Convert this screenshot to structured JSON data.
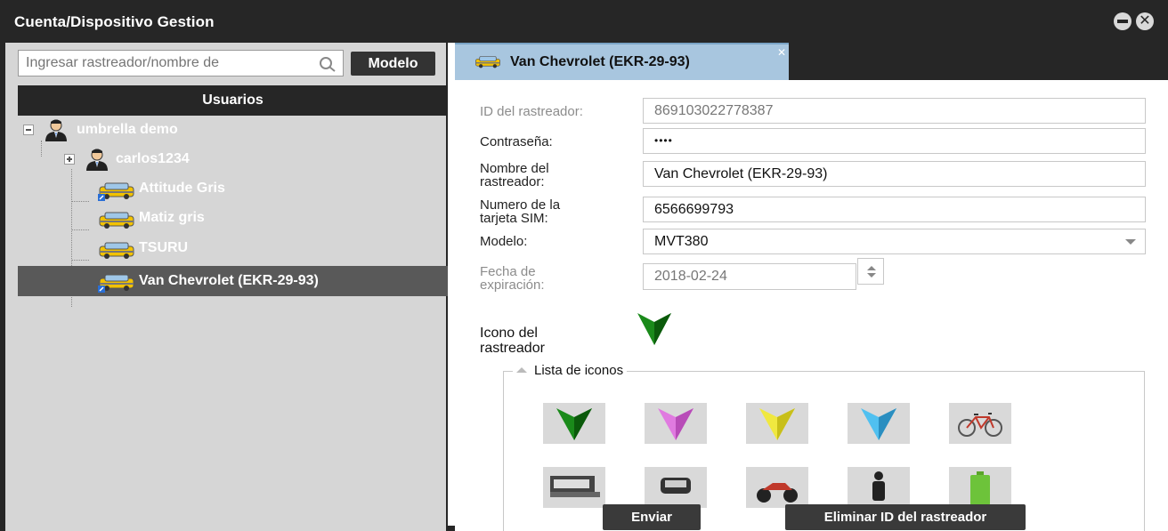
{
  "window": {
    "title": "Cuenta/Dispositivo Gestion"
  },
  "sidebar": {
    "search_placeholder": "Ingresar rastreador/nombre de",
    "model_button": "Modelo",
    "users_header": "Usuarios",
    "tree": [
      {
        "label": "umbrella demo",
        "type": "user",
        "expander": "minus",
        "level": 0
      },
      {
        "label": "carlos1234",
        "type": "user",
        "expander": "plus",
        "level": 1
      },
      {
        "label": "Attitude Gris",
        "type": "vehicle",
        "level": 2
      },
      {
        "label": "Matiz gris",
        "type": "vehicle",
        "level": 2
      },
      {
        "label": "TSURU",
        "type": "vehicle",
        "level": 2
      },
      {
        "label": "Van Chevrolet (EKR-29-93)",
        "type": "vehicle",
        "level": 2,
        "selected": true
      }
    ]
  },
  "tab": {
    "label": "Van Chevrolet (EKR-29-93)"
  },
  "form": {
    "tracker_id_label": "ID del rastreador:",
    "tracker_id_value": "869103022778387",
    "password_label": "Contraseña:",
    "password_value": "••••",
    "name_label_1": "Nombre del",
    "name_label_2": "rastreador:",
    "name_value": "Van Chevrolet (EKR-29-93)",
    "sim_label_1": "Numero de la",
    "sim_label_2": "tarjeta SIM:",
    "sim_value": "6566699793",
    "model_label": "Modelo:",
    "model_value": "MVT380",
    "expiry_label_1": "Fecha de",
    "expiry_label_2": "expiración:",
    "expiry_value": "2018-02-24",
    "icon_label_1": "Icono del",
    "icon_label_2": "rastreador",
    "icon_list_legend": "Lista de iconos",
    "icons": [
      {
        "name": "green-arrow-icon",
        "color": "#1a8a1a"
      },
      {
        "name": "pink-arrow-icon",
        "color": "#e07ae0"
      },
      {
        "name": "yellow-arrow-icon",
        "color": "#e8e030"
      },
      {
        "name": "blue-arrow-icon",
        "color": "#40b0e8"
      },
      {
        "name": "bicycle-icon"
      },
      {
        "name": "truck-icon"
      },
      {
        "name": "car-icon"
      },
      {
        "name": "motorcycle-icon"
      },
      {
        "name": "person-icon"
      },
      {
        "name": "battery-icon"
      }
    ],
    "submit_button": "Enviar",
    "delete_button": "Eliminar ID del rastreador"
  },
  "colors": {
    "dark": "#262626",
    "sidebar_bg": "#d6d6d6",
    "selected_row": "#595959",
    "tab_active": "#a8c6df"
  }
}
